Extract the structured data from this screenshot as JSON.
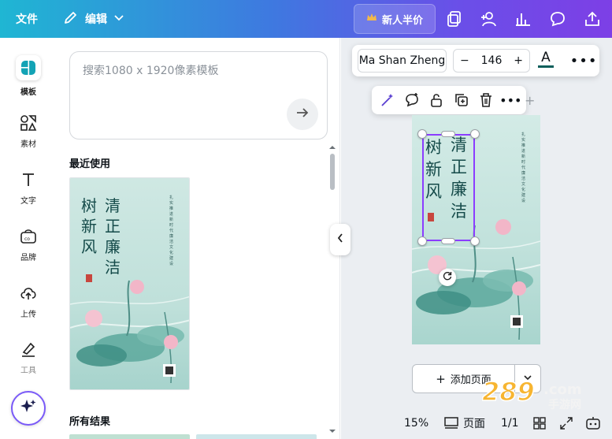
{
  "topbar": {
    "file_label": "文件",
    "edit_label": "编辑",
    "upgrade_label": "新人半价"
  },
  "rail": {
    "items": [
      {
        "label": "模板",
        "icon": "template-icon"
      },
      {
        "label": "素材",
        "icon": "elements-icon"
      },
      {
        "label": "文字",
        "icon": "text-icon"
      },
      {
        "label": "品牌",
        "icon": "brand-icon"
      },
      {
        "label": "上传",
        "icon": "upload-icon"
      },
      {
        "label": "工具",
        "icon": "tools-icon"
      }
    ]
  },
  "panel": {
    "search_placeholder": "搜索1080 x 1920像素模板",
    "recent_title": "最近使用",
    "results_title": "所有结果"
  },
  "template": {
    "title_col1": "树新风",
    "title_col2": "清正廉洁",
    "subtitle": "扎实推进新时代廉洁文化建设"
  },
  "text_toolbar": {
    "font_name": "Ma Shan Zheng",
    "font_size": "146",
    "color_label": "A",
    "text_color": "#0d5f5b"
  },
  "canvas": {
    "add_page_label": "添加页面"
  },
  "bottom": {
    "zoom": "15%",
    "pages_label": "页面",
    "page_count": "1/1"
  },
  "watermark": {
    "text": "289",
    "domain": ".com",
    "sub": "手游网"
  },
  "colors": {
    "accent": "#8b3dff",
    "topbar_start": "#1fb6d3",
    "topbar_end": "#7d3fe6"
  }
}
